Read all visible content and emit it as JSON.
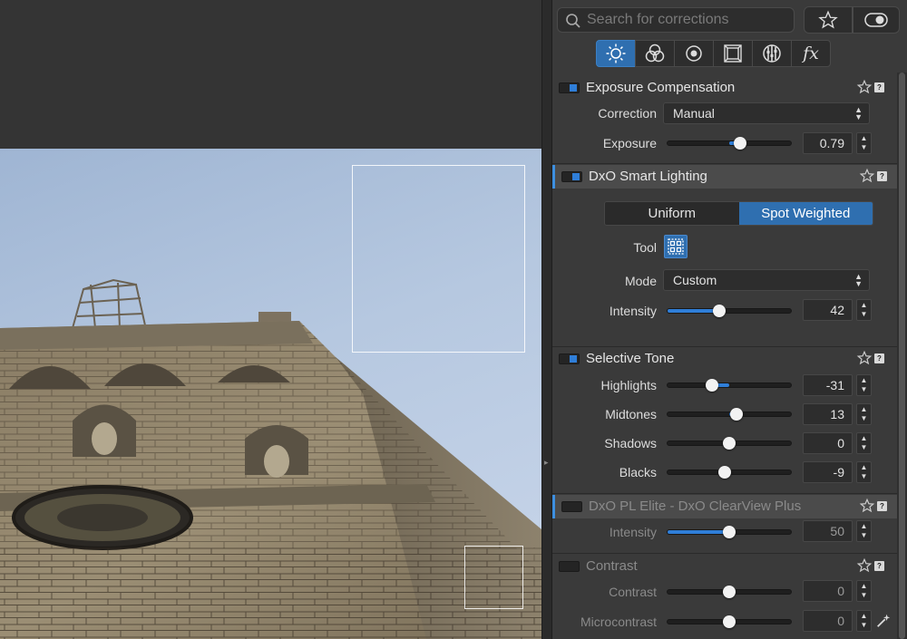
{
  "search": {
    "placeholder": "Search for corrections"
  },
  "toolbar": {
    "favorites_icon": "star-icon",
    "toggle_icon": "toggle-icon"
  },
  "tabs": [
    {
      "icon": "sun-icon",
      "active": true
    },
    {
      "icon": "color-circles-icon"
    },
    {
      "icon": "lens-detail-icon"
    },
    {
      "icon": "geometry-icon"
    },
    {
      "icon": "local-adjust-icon"
    },
    {
      "label": "fx"
    }
  ],
  "sections": {
    "exposure": {
      "title": "Exposure Compensation",
      "correction_label": "Correction",
      "correction_value": "Manual",
      "exposure_label": "Exposure",
      "exposure_value": "0.79",
      "exposure_fraction": 0.59
    },
    "smart_lighting": {
      "title": "DxO Smart Lighting",
      "modes": [
        "Uniform",
        "Spot Weighted"
      ],
      "active_mode": "Spot Weighted",
      "tool_label": "Tool",
      "mode_label": "Mode",
      "mode_value": "Custom",
      "intensity_label": "Intensity",
      "intensity_value": "42",
      "intensity_fraction": 0.42
    },
    "selective_tone": {
      "title": "Selective Tone",
      "rows": [
        {
          "label": "Highlights",
          "value": "-31",
          "fraction": 0.36
        },
        {
          "label": "Midtones",
          "value": "13",
          "fraction": 0.56
        },
        {
          "label": "Shadows",
          "value": "0",
          "fraction": 0.5
        },
        {
          "label": "Blacks",
          "value": "-9",
          "fraction": 0.46
        }
      ]
    },
    "clearview": {
      "title": "DxO PL Elite - DxO ClearView Plus",
      "intensity_label": "Intensity",
      "intensity_value": "50",
      "intensity_fraction": 0.5
    },
    "contrast": {
      "title": "Contrast",
      "contrast_label": "Contrast",
      "contrast_value": "0",
      "contrast_fraction": 0.5,
      "micro_label": "Microcontrast",
      "micro_value": "0",
      "micro_fraction": 0.5
    }
  },
  "colors": {
    "accent": "#2f7ed8",
    "panel": "#3a3a3a"
  }
}
